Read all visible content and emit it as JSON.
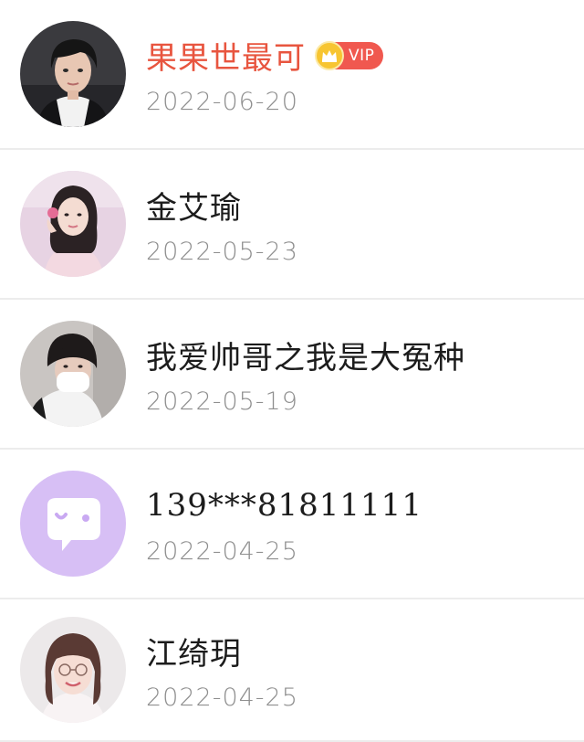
{
  "users": [
    {
      "name": "果果世最可",
      "date": "2022-06-20",
      "vip": true,
      "vip_label": "VIP",
      "avatar": "photo-young-man-dark-hair",
      "name_color": "#e8553f"
    },
    {
      "name": "金艾瑜",
      "date": "2022-05-23",
      "vip": false,
      "avatar": "photo-woman-pink-background"
    },
    {
      "name": "我爱帅哥之我是大冤种",
      "date": "2022-05-19",
      "vip": false,
      "avatar": "photo-man-white-mask"
    },
    {
      "name": "139***81811111",
      "date": "2022-04-25",
      "vip": false,
      "avatar": "default-chat-bubble-icon"
    },
    {
      "name": "江绮玥",
      "date": "2022-04-25",
      "vip": false,
      "avatar": "photo-woman-glasses"
    }
  ],
  "colors": {
    "vip_badge": "#f0584f",
    "vip_crown": "#f7c531",
    "date_text": "#8f8f8f",
    "default_avatar_bg": "#d7bff5"
  }
}
